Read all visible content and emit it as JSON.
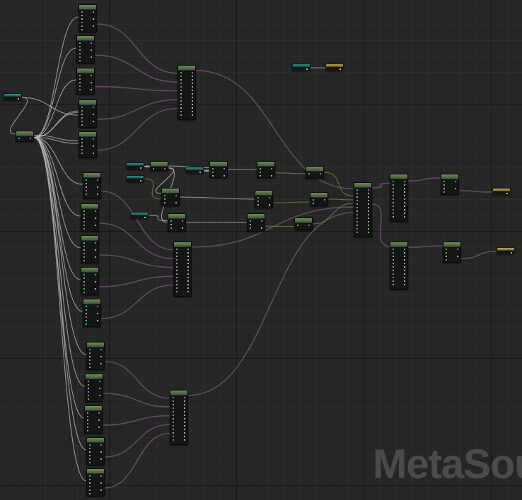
{
  "app": {
    "watermark": "MetaSou"
  },
  "colors": {
    "background": "#262626",
    "wire_audio": "#6b4d6e",
    "wire_trigger": "#bdbdbd",
    "wire_float": "#5f7f3d",
    "node_header": "#5e7a4e",
    "input_var": "#2f8a86",
    "output_var": "#b5a452"
  },
  "icons": [
    "pin-dot-icon"
  ]
}
